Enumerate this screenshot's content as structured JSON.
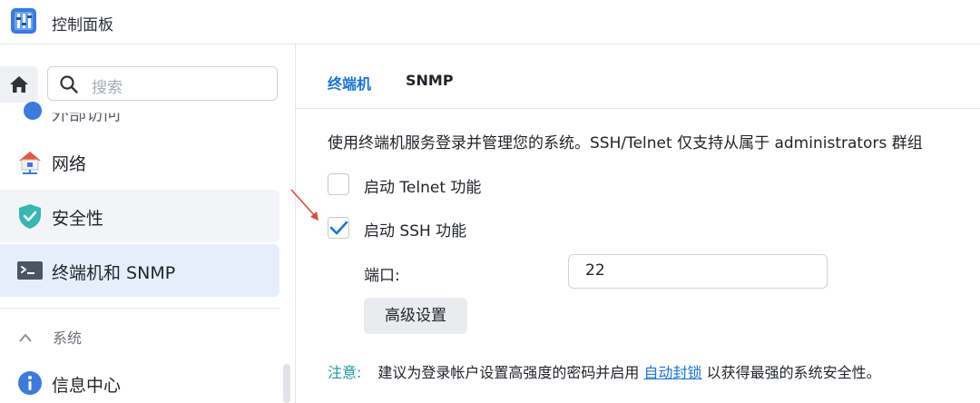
{
  "app": {
    "title": "控制面板"
  },
  "search": {
    "placeholder": "搜索"
  },
  "sidebar": {
    "items": [
      {
        "label": "外部访问"
      },
      {
        "label": "网络"
      },
      {
        "label": "安全性"
      },
      {
        "label": "终端机和 SNMP"
      }
    ],
    "section": "系统",
    "section_items": [
      {
        "label": "信息中心"
      }
    ]
  },
  "tabs": [
    {
      "label": "终端机"
    },
    {
      "label": "SNMP"
    }
  ],
  "terminal": {
    "description": "使用终端机服务登录并管理您的系统。SSH/Telnet 仅支持从属于 administrators 群组",
    "telnet_label": "启动 Telnet 功能",
    "telnet_enabled": false,
    "ssh_label": "启动 SSH 功能",
    "ssh_enabled": true,
    "port_label": "端口:",
    "port_value": "22",
    "advanced_button": "高级设置",
    "note_prefix": "注意:",
    "note_text_1": "建议为登录帐户设置高强度的密码并启用",
    "note_link": "自动封锁",
    "note_text_2": "以获得最强的系统安全性。"
  },
  "colors": {
    "accent": "#1a73d9",
    "selected_bg": "#e7eefb",
    "note": "#1a9a9a",
    "annotation_arrow": "#e8453c"
  }
}
